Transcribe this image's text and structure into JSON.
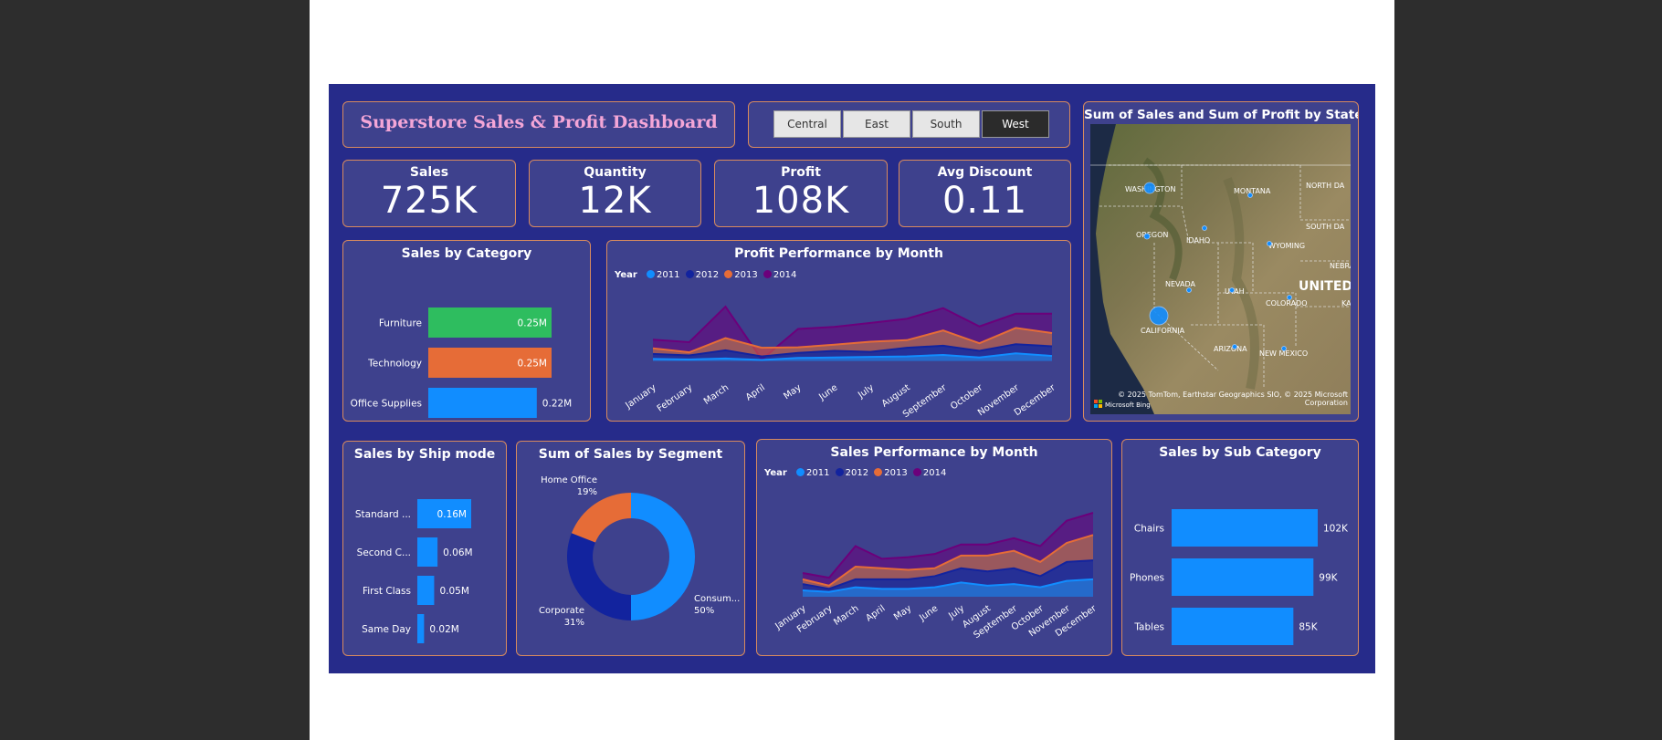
{
  "title": "Superstore Sales & Profit Dashboard",
  "slicer": {
    "options": [
      "Central",
      "East",
      "South",
      "West"
    ],
    "selected": "West"
  },
  "kpis": [
    {
      "label": "Sales",
      "value": "725K"
    },
    {
      "label": "Quantity",
      "value": "12K"
    },
    {
      "label": "Profit",
      "value": "108K"
    },
    {
      "label": "Avg Discount",
      "value": "0.11"
    }
  ],
  "map": {
    "title": "Sum of Sales and Sum of Profit by State",
    "labels": [
      "WASHINGTON",
      "MONTANA",
      "NORTH DA",
      "OREGON",
      "IDAHO",
      "WYOMING",
      "SOUTH DA",
      "NEBRA",
      "NEVADA",
      "UTAH",
      "UNITED",
      "COLORADO",
      "KA",
      "CALIFORNIA",
      "ARIZONA",
      "NEW MEXICO"
    ],
    "attribution": "© 2025 TomTom, Earthstar Geographics SIO, © 2025 Microsoft Corporation",
    "brand": "Microsoft Bing"
  },
  "colors": {
    "dashboard_bg": "#262b8a",
    "card_bg": "#3e418d",
    "card_border": "#d88a5e",
    "y2011": "#118dff",
    "y2012": "#12239e",
    "y2013": "#e66c37",
    "y2014": "#6b007b",
    "furniture": "#2ebd5f"
  },
  "chart_data": [
    {
      "id": "sales_by_category",
      "type": "bar",
      "orientation": "horizontal",
      "title": "Sales by Category",
      "categories": [
        "Furniture",
        "Technology",
        "Office Supplies"
      ],
      "values": [
        0.25,
        0.25,
        0.22
      ],
      "value_labels": [
        "0.25M",
        "0.25M",
        "0.22M"
      ],
      "bar_colors": [
        "#2ebd5f",
        "#e66c37",
        "#118dff"
      ]
    },
    {
      "id": "profit_by_month",
      "type": "area",
      "stacked": true,
      "title": "Profit Performance by Month",
      "legend_title": "Year",
      "categories": [
        "January",
        "February",
        "March",
        "April",
        "May",
        "June",
        "July",
        "August",
        "September",
        "October",
        "November",
        "December"
      ],
      "series": [
        {
          "name": "2011",
          "values": [
            400,
            300,
            500,
            200,
            600,
            700,
            800,
            900,
            1200,
            700,
            1500,
            1000
          ]
        },
        {
          "name": "2012",
          "values": [
            1000,
            800,
            1600,
            700,
            1000,
            1300,
            1000,
            1700,
            1800,
            1300,
            1800,
            1900
          ]
        },
        {
          "name": "2013",
          "values": [
            1100,
            600,
            2400,
            1700,
            1100,
            1200,
            2000,
            1500,
            3000,
            1500,
            3200,
            2600
          ]
        },
        {
          "name": "2014",
          "values": [
            1700,
            2000,
            6200,
            -2300,
            3600,
            3500,
            3700,
            4200,
            4400,
            3300,
            2800,
            3800
          ]
        }
      ]
    },
    {
      "id": "sales_by_ship_mode",
      "type": "bar",
      "orientation": "horizontal",
      "title": "Sales by Ship mode",
      "categories": [
        "Standard ...",
        "Second C...",
        "First Class",
        "Same Day"
      ],
      "values": [
        0.16,
        0.06,
        0.05,
        0.02
      ],
      "value_labels": [
        "0.16M",
        "0.06M",
        "0.05M",
        "0.02M"
      ]
    },
    {
      "id": "sales_by_segment",
      "type": "pie",
      "donut": true,
      "title": "Sum of Sales by Segment",
      "slices": [
        {
          "label": "Consum...",
          "pct_label": "50%",
          "value": 50,
          "color": "#118dff"
        },
        {
          "label": "Corporate",
          "pct_label": "31%",
          "value": 31,
          "color": "#12239e"
        },
        {
          "label": "Home Office",
          "pct_label": "19%",
          "value": 19,
          "color": "#e66c37"
        }
      ]
    },
    {
      "id": "sales_by_month",
      "type": "area",
      "stacked": true,
      "title": "Sales Performance by Month",
      "legend_title": "Year",
      "categories": [
        "January",
        "February",
        "March",
        "April",
        "May",
        "June",
        "July",
        "August",
        "September",
        "October",
        "November",
        "December"
      ],
      "series": [
        {
          "name": "2011",
          "values": [
            4000,
            3000,
            6000,
            5000,
            5000,
            6000,
            9000,
            7000,
            8000,
            6000,
            10000,
            11000
          ]
        },
        {
          "name": "2012",
          "values": [
            4000,
            2000,
            5000,
            6000,
            6000,
            7000,
            9000,
            9000,
            10000,
            7000,
            12000,
            12000
          ]
        },
        {
          "name": "2013",
          "values": [
            3000,
            2000,
            8000,
            7000,
            6000,
            5000,
            8000,
            10000,
            11000,
            9000,
            12000,
            16000
          ]
        },
        {
          "name": "2014",
          "values": [
            4000,
            5000,
            13000,
            6000,
            8000,
            9000,
            7000,
            7000,
            8000,
            10000,
            14000,
            14000
          ]
        }
      ]
    },
    {
      "id": "sales_by_sub_category",
      "type": "bar",
      "orientation": "horizontal",
      "title": "Sales by Sub Category",
      "categories": [
        "Chairs",
        "Phones",
        "Tables"
      ],
      "values": [
        102,
        99,
        85
      ],
      "value_labels": [
        "102K",
        "99K",
        "85K"
      ]
    }
  ]
}
